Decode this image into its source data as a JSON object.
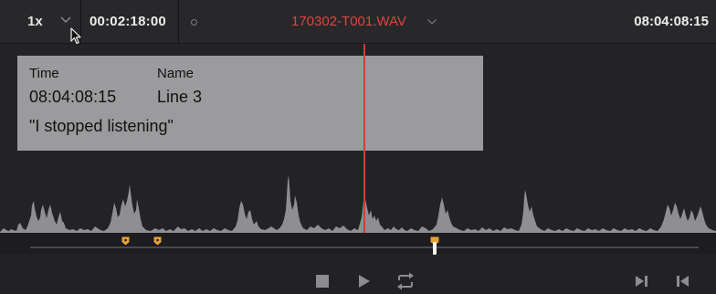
{
  "toolbar": {
    "speed_label": "1x",
    "timecode_current": "00:02:18:00",
    "clip_name": "170302-T001.WAV",
    "timecode_source": "08:04:08:15"
  },
  "info_panel": {
    "time_header": "Time",
    "name_header": "Name",
    "time_value": "08:04:08:15",
    "name_value": "Line 3",
    "quote": "\"I stopped listening\""
  },
  "colors": {
    "playhead": "#c9403a",
    "clip_name": "#d9473e",
    "marker": "#e8a23a",
    "waveform": "#8f8f92"
  },
  "icons": {
    "speed_dropdown": "chevron-down-icon",
    "clip_dropdown": "chevron-down-icon",
    "stop": "stop-icon",
    "play": "play-icon",
    "loop": "loop-icon",
    "next_marker": "skip-to-end-icon",
    "prev_marker": "skip-to-start-icon"
  }
}
